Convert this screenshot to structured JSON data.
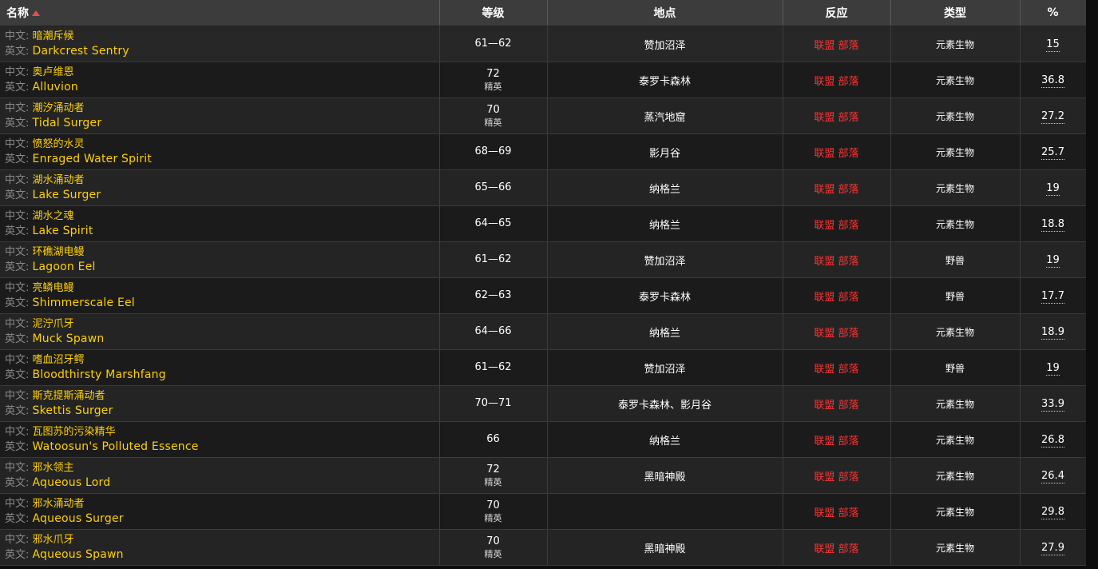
{
  "header": {
    "name": "名称",
    "level": "等级",
    "location": "地点",
    "reaction": "反应",
    "type": "类型",
    "percent": "%"
  },
  "labels": {
    "cn": "中文:",
    "en": "英文:",
    "elite": "精英"
  },
  "colors": {
    "name": "#ffd100",
    "reaction": "#ff3333",
    "sort_arrow": "#e0524d"
  },
  "rows": [
    {
      "cn": "暗潮斥候",
      "en": "Darkcrest Sentry",
      "level": "61—62",
      "elite": false,
      "location": "赞加沼泽",
      "reaction": "联盟 部落",
      "type": "元素生物",
      "pct": "15"
    },
    {
      "cn": "奥卢维恩",
      "en": "Alluvion",
      "level": "72",
      "elite": true,
      "location": "泰罗卡森林",
      "reaction": "联盟 部落",
      "type": "元素生物",
      "pct": "36.8"
    },
    {
      "cn": "潮汐涌动者",
      "en": "Tidal Surger",
      "level": "70",
      "elite": true,
      "location": "蒸汽地窟",
      "reaction": "联盟 部落",
      "type": "元素生物",
      "pct": "27.2"
    },
    {
      "cn": "愤怒的水灵",
      "en": "Enraged Water Spirit",
      "level": "68—69",
      "elite": false,
      "location": "影月谷",
      "reaction": "联盟 部落",
      "type": "元素生物",
      "pct": "25.7"
    },
    {
      "cn": "湖水涌动者",
      "en": "Lake Surger",
      "level": "65—66",
      "elite": false,
      "location": "纳格兰",
      "reaction": "联盟 部落",
      "type": "元素生物",
      "pct": "19"
    },
    {
      "cn": "湖水之魂",
      "en": "Lake Spirit",
      "level": "64—65",
      "elite": false,
      "location": "纳格兰",
      "reaction": "联盟 部落",
      "type": "元素生物",
      "pct": "18.8"
    },
    {
      "cn": "环礁湖电鳗",
      "en": "Lagoon Eel",
      "level": "61—62",
      "elite": false,
      "location": "赞加沼泽",
      "reaction": "联盟 部落",
      "type": "野兽",
      "pct": "19"
    },
    {
      "cn": "亮鳞电鳗",
      "en": "Shimmerscale Eel",
      "level": "62—63",
      "elite": false,
      "location": "泰罗卡森林",
      "reaction": "联盟 部落",
      "type": "野兽",
      "pct": "17.7"
    },
    {
      "cn": "泥泞爪牙",
      "en": "Muck Spawn",
      "level": "64—66",
      "elite": false,
      "location": "纳格兰",
      "reaction": "联盟 部落",
      "type": "元素生物",
      "pct": "18.9"
    },
    {
      "cn": "嗜血沼牙鳄",
      "en": "Bloodthirsty Marshfang",
      "level": "61—62",
      "elite": false,
      "location": "赞加沼泽",
      "reaction": "联盟 部落",
      "type": "野兽",
      "pct": "19"
    },
    {
      "cn": "斯克提斯涌动者",
      "en": "Skettis Surger",
      "level": "70—71",
      "elite": false,
      "location": "泰罗卡森林、影月谷",
      "reaction": "联盟 部落",
      "type": "元素生物",
      "pct": "33.9"
    },
    {
      "cn": "瓦图苏的污染精华",
      "en": "Watoosun's Polluted Essence",
      "level": "66",
      "elite": false,
      "location": "纳格兰",
      "reaction": "联盟 部落",
      "type": "元素生物",
      "pct": "26.8"
    },
    {
      "cn": "邪水领主",
      "en": "Aqueous Lord",
      "level": "72",
      "elite": true,
      "location": "黑暗神殿",
      "reaction": "联盟 部落",
      "type": "元素生物",
      "pct": "26.4"
    },
    {
      "cn": "邪水涌动者",
      "en": "Aqueous Surger",
      "level": "70",
      "elite": true,
      "location": "",
      "reaction": "联盟 部落",
      "type": "元素生物",
      "pct": "29.8"
    },
    {
      "cn": "邪水爪牙",
      "en": "Aqueous Spawn",
      "level": "70",
      "elite": true,
      "location": "黑暗神殿",
      "reaction": "联盟 部落",
      "type": "元素生物",
      "pct": "27.9"
    }
  ]
}
